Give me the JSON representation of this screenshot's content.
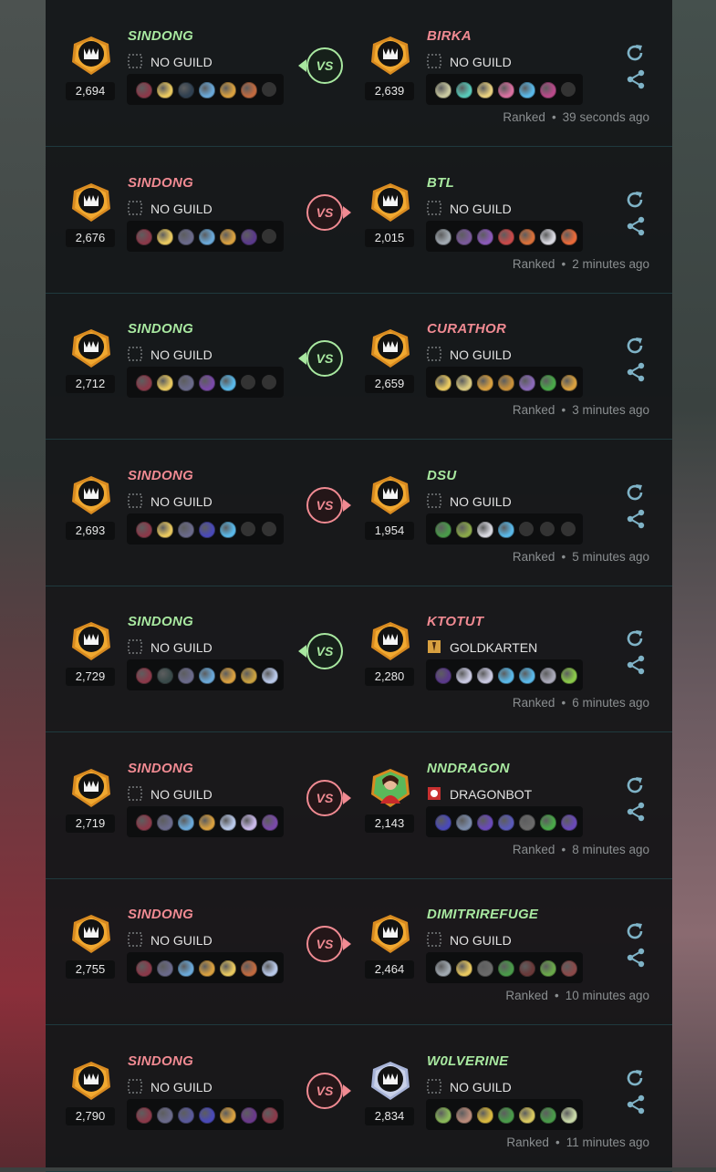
{
  "matches": [
    {
      "left": {
        "name": "SINDONG",
        "guild": "NO GUILD",
        "rating": "2,694",
        "result": "win",
        "team": [
          "#8a3a4a",
          "#e8c860",
          "#304050",
          "#6aa8d8",
          "#d8a040",
          "#c06a40",
          "#333333"
        ]
      },
      "right": {
        "name": "BIRKA",
        "guild": "NO GUILD",
        "rating": "2,639",
        "result": "loss",
        "team": [
          "#c8c8a0",
          "#58c8b8",
          "#e8d080",
          "#d870a0",
          "#5ab8e8",
          "#b84a8a",
          "#333333"
        ]
      },
      "vs": "VS",
      "outcome": "win",
      "mode": "Ranked",
      "time": "39 seconds ago"
    },
    {
      "left": {
        "name": "SINDONG",
        "guild": "NO GUILD",
        "rating": "2,676",
        "result": "loss",
        "team": [
          "#8a3a4a",
          "#e8c860",
          "#6a6a8a",
          "#6aa8d8",
          "#d8a040",
          "#5a3a8a",
          "#333333"
        ]
      },
      "right": {
        "name": "BTL",
        "guild": "NO GUILD",
        "rating": "2,015",
        "result": "win",
        "team": [
          "#a0a8b0",
          "#7a5a9a",
          "#8a5ab8",
          "#c84a4a",
          "#d8703a",
          "#d8d8e0",
          "#e86a3a"
        ]
      },
      "vs": "VS",
      "outcome": "loss",
      "mode": "Ranked",
      "time": "2 minutes ago"
    },
    {
      "left": {
        "name": "SINDONG",
        "guild": "NO GUILD",
        "rating": "2,712",
        "result": "win",
        "team": [
          "#8a3a4a",
          "#e8c860",
          "#6a6a8a",
          "#7a4aa8",
          "#5ab8e8",
          "#333333",
          "#333333"
        ]
      },
      "right": {
        "name": "CURATHOR",
        "guild": "NO GUILD",
        "rating": "2,659",
        "result": "loss",
        "team": [
          "#e8c860",
          "#d8c880",
          "#d8a040",
          "#c8903a",
          "#8a6ab8",
          "#4aa84a",
          "#d8a040"
        ]
      },
      "vs": "VS",
      "outcome": "win",
      "mode": "Ranked",
      "time": "3 minutes ago"
    },
    {
      "left": {
        "name": "SINDONG",
        "guild": "NO GUILD",
        "rating": "2,693",
        "result": "loss",
        "team": [
          "#8a3a4a",
          "#e8c860",
          "#6a6a8a",
          "#4a4ab8",
          "#5ab8e8",
          "#333333",
          "#333333"
        ]
      },
      "right": {
        "name": "DSU",
        "guild": "NO GUILD",
        "rating": "1,954",
        "result": "win",
        "team": [
          "#4a9a4a",
          "#8aa84a",
          "#d8d8e0",
          "#5ab8e8",
          "#333333",
          "#333333",
          "#333333"
        ]
      },
      "vs": "VS",
      "outcome": "loss",
      "mode": "Ranked",
      "time": "5 minutes ago"
    },
    {
      "left": {
        "name": "SINDONG",
        "guild": "NO GUILD",
        "rating": "2,729",
        "result": "win",
        "team": [
          "#8a3a4a",
          "#3a4a4a",
          "#6a6a8a",
          "#6aa8d8",
          "#d8a040",
          "#c8a040",
          "#b8c8e8"
        ]
      },
      "right": {
        "name": "KTOTUT",
        "guild": "GOLDKARTEN",
        "rating": "2,280",
        "result": "loss",
        "team": [
          "#5a3a8a",
          "#c8c8e0",
          "#c8c8e0",
          "#5ab8e8",
          "#5ab8e8",
          "#a8a8b8",
          "#8ac84a"
        ]
      },
      "vs": "VS",
      "outcome": "win",
      "mode": "Ranked",
      "time": "6 minutes ago"
    },
    {
      "left": {
        "name": "SINDONG",
        "guild": "NO GUILD",
        "rating": "2,719",
        "result": "loss",
        "team": [
          "#8a3a4a",
          "#6a6a8a",
          "#6aa8d8",
          "#d8a040",
          "#b8c8e8",
          "#c8b8e8",
          "#7a4aa8"
        ]
      },
      "right": {
        "name": "NNDRAGON",
        "guild": "DRAGONBOT",
        "rating": "2,143",
        "result": "win",
        "team": [
          "#4a4ab8",
          "#7a8aa8",
          "#6a4ab8",
          "#5a5ab8",
          "#6a6a6a",
          "#4aa84a",
          "#6a4ab8"
        ]
      },
      "vs": "VS",
      "outcome": "loss",
      "mode": "Ranked",
      "time": "8 minutes ago"
    },
    {
      "left": {
        "name": "SINDONG",
        "guild": "NO GUILD",
        "rating": "2,755",
        "result": "loss",
        "team": [
          "#8a3a4a",
          "#6a6a8a",
          "#6aa8d8",
          "#d8a040",
          "#e8c860",
          "#c06a40",
          "#b8c8e8"
        ]
      },
      "right": {
        "name": "DIMITRIREFUGE",
        "guild": "NO GUILD",
        "rating": "2,464",
        "result": "win",
        "team": [
          "#a0a8b0",
          "#e8c860",
          "#6a6a6a",
          "#4a9a4a",
          "#6a3a3a",
          "#6aa84a",
          "#8a4a4a"
        ]
      },
      "vs": "VS",
      "outcome": "loss",
      "mode": "Ranked",
      "time": "10 minutes ago"
    },
    {
      "left": {
        "name": "SINDONG",
        "guild": "NO GUILD",
        "rating": "2,790",
        "result": "loss",
        "team": [
          "#8a3a4a",
          "#6a6a8a",
          "#5a5a9a",
          "#4a4ab8",
          "#d8a040",
          "#6a3a8a",
          "#8a3a4a"
        ]
      },
      "right": {
        "name": "W0LVERINE",
        "guild": "NO GUILD",
        "rating": "2,834",
        "result": "win",
        "team": [
          "#8ab85a",
          "#b88a7a",
          "#d8b840",
          "#4a9a4a",
          "#d8c860",
          "#4a9a4a",
          "#c8d8a8"
        ]
      },
      "vs": "VS",
      "outcome": "loss",
      "mode": "Ranked",
      "time": "11 minutes ago"
    }
  ],
  "colors": {
    "win": "#a8e8a0",
    "loss": "#f08a92",
    "accent": "#7fb3c7",
    "panel": "#141618"
  },
  "icons": {
    "refresh": "refresh-icon",
    "share": "share-icon",
    "guild_none": "no-guild-icon",
    "league": "league-badge-icon"
  }
}
